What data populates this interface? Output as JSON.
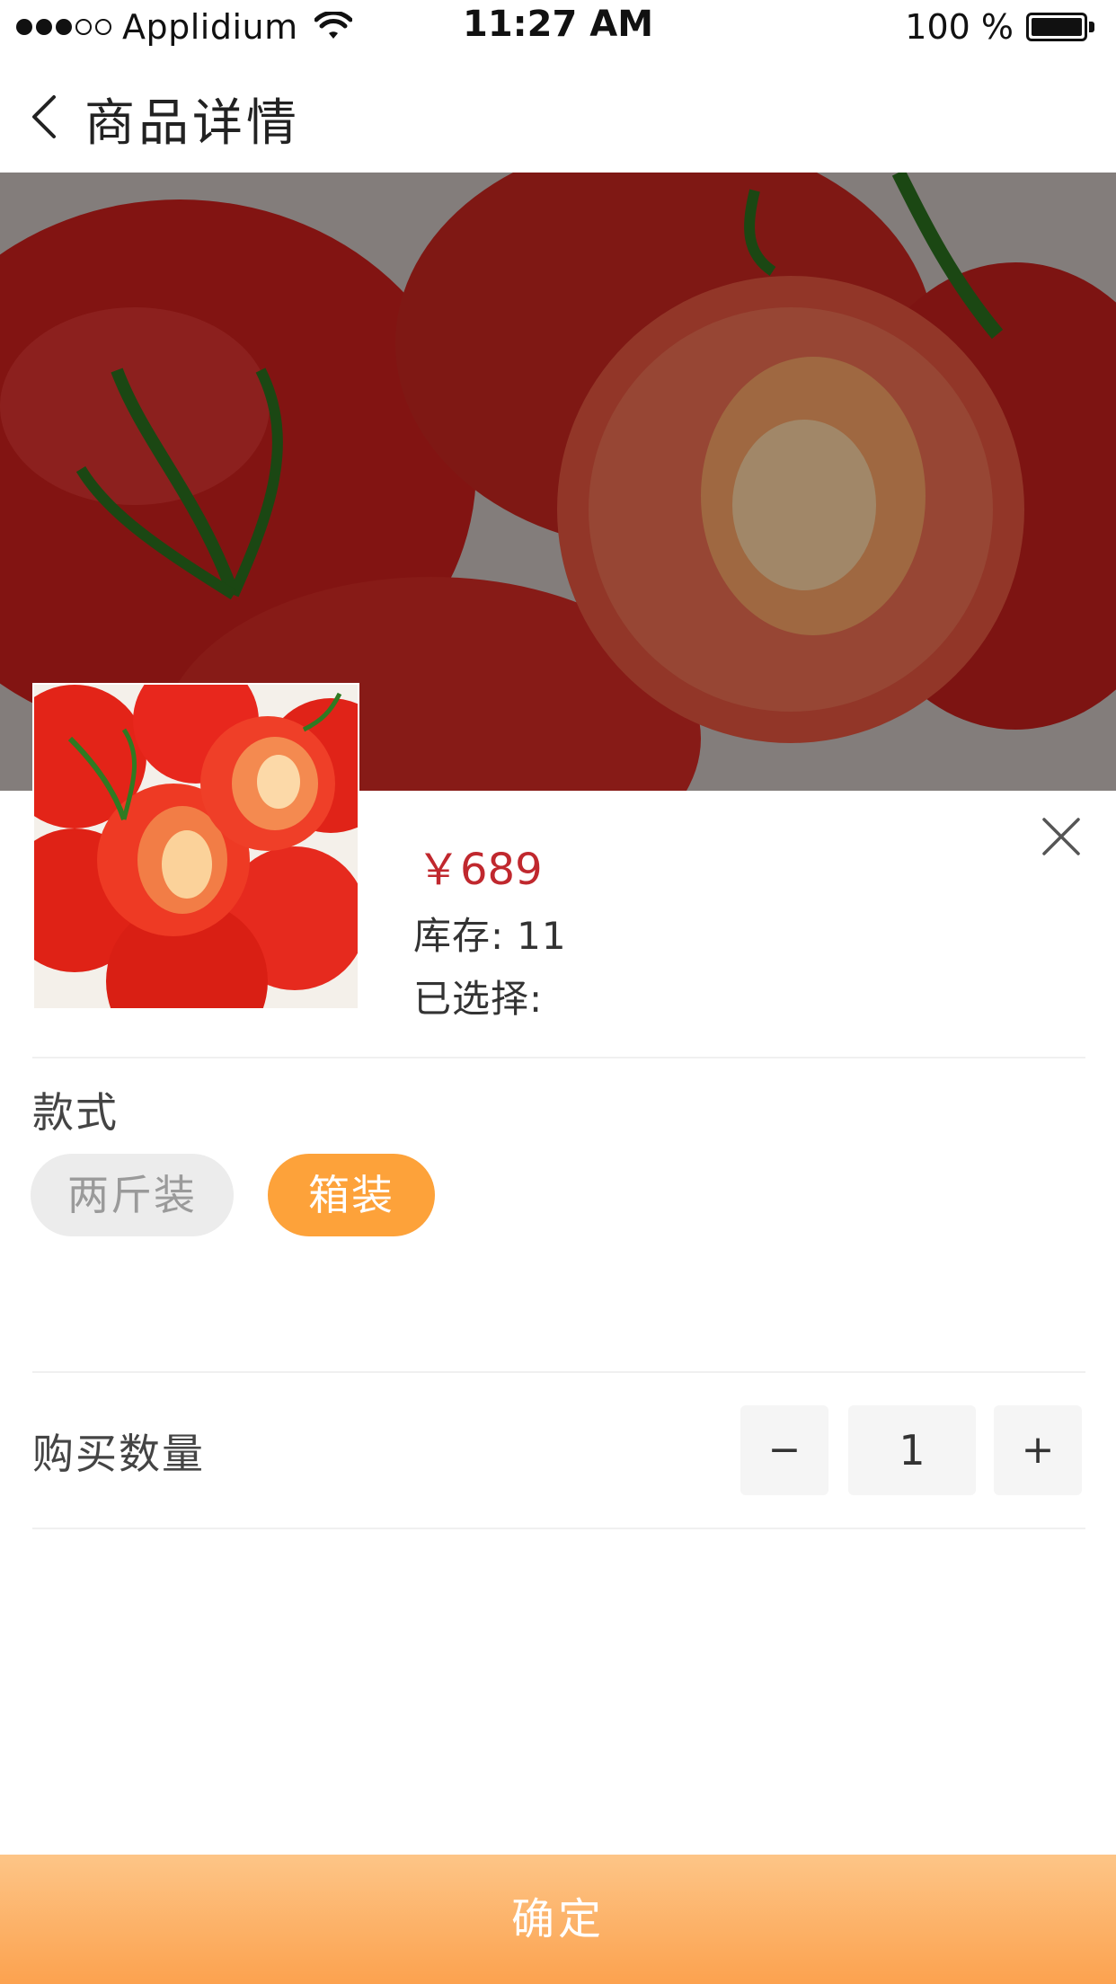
{
  "status_bar": {
    "carrier": "Applidium",
    "time": "11:27 AM",
    "battery": "100 %"
  },
  "nav": {
    "title": "商品详情",
    "back_icon": "chevron-left-icon"
  },
  "product": {
    "price": "￥689",
    "stock_label": "库存:",
    "stock_value": "11",
    "selected_label": "已选择:",
    "close_icon": "close-icon"
  },
  "style_section": {
    "label": "款式",
    "options": [
      {
        "label": "两斤装",
        "selected": false
      },
      {
        "label": "箱装",
        "selected": true
      }
    ]
  },
  "quantity": {
    "label": "购买数量",
    "minus": "−",
    "value": "1",
    "plus": "+"
  },
  "confirm": {
    "label": "确定"
  },
  "colors": {
    "accent": "#fda23a",
    "price": "#c0282e"
  }
}
